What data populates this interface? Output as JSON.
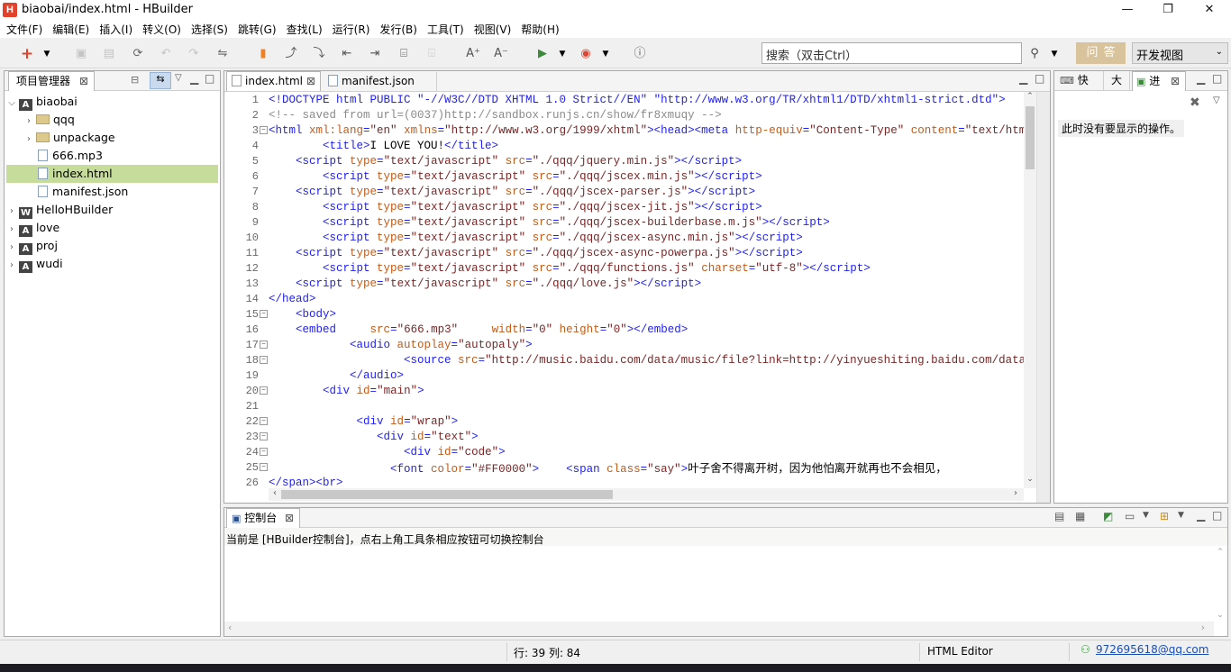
{
  "window": {
    "title": "biaobai/index.html  -  HBuilder",
    "app_icon": "H",
    "minimize": "—",
    "maximize": "❐",
    "close": "✕"
  },
  "menu": [
    "文件(F)",
    "编辑(E)",
    "插入(I)",
    "转义(O)",
    "选择(S)",
    "跳转(G)",
    "查找(L)",
    "运行(R)",
    "发行(B)",
    "工具(T)",
    "视图(V)",
    "帮助(H)"
  ],
  "toolbar": {
    "search_placeholder": "搜索（双击Ctrl）",
    "ask_label": "问答",
    "view_selected": "开发视图"
  },
  "project_panel": {
    "title": "项目管理器",
    "tree": [
      {
        "label": "biaobai",
        "icon": "project",
        "expanded": true,
        "level": 0
      },
      {
        "label": "qqq",
        "icon": "folder",
        "level": 1
      },
      {
        "label": "unpackage",
        "icon": "folder",
        "level": 1
      },
      {
        "label": "666.mp3",
        "icon": "file",
        "level": 1
      },
      {
        "label": "index.html",
        "icon": "file",
        "level": 1,
        "selected": true
      },
      {
        "label": "manifest.json",
        "icon": "file",
        "level": 1
      },
      {
        "label": "HelloHBuilder",
        "icon": "project-w",
        "level": 0
      },
      {
        "label": "love",
        "icon": "project",
        "level": 0
      },
      {
        "label": "proj",
        "icon": "project",
        "level": 0
      },
      {
        "label": "wudi",
        "icon": "project",
        "level": 0
      }
    ]
  },
  "editor": {
    "tabs": [
      "index.html",
      "manifest.json"
    ],
    "active_tab": 0
  },
  "outline_panel": {
    "tabs": [
      "快",
      "大",
      "进"
    ],
    "message": "此时没有要显示的操作。"
  },
  "console": {
    "title": "控制台",
    "message": "当前是 [HBuilder控制台]，点右上角工具条相应按钮可切换控制台"
  },
  "status": {
    "position": "行: 39 列: 84",
    "editor_type": "HTML Editor",
    "user": "972695618@qq.com"
  },
  "colors": {
    "selection": "#c6dc9a",
    "tag": "#1f1ff2",
    "attribute": "#c15c1a",
    "value": "#7a2626",
    "comment": "#8a8a8a",
    "ask_button": "#d8c39c"
  }
}
